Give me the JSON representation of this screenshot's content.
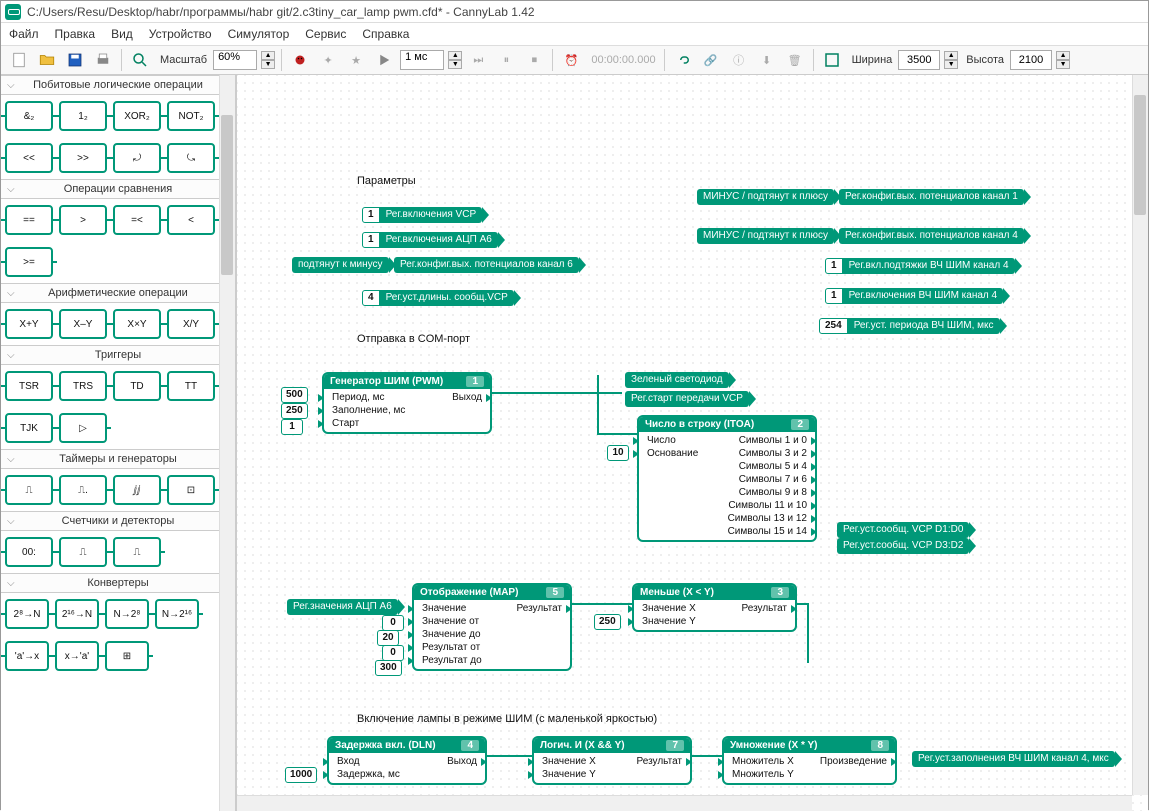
{
  "window": {
    "title": "C:/Users/Resu/Desktop/habr/программы/habr git/2.c3tiny_car_lamp pwm.cfd* - CannyLab 1.42"
  },
  "menu": {
    "file": "Файл",
    "edit": "Правка",
    "view": "Вид",
    "device": "Устройство",
    "simulator": "Симулятор",
    "service": "Сервис",
    "help": "Справка"
  },
  "toolbar": {
    "zoom_label": "Масштаб",
    "zoom_value": "60%",
    "time_step": "1 мс",
    "time_display": "00:00:00.000",
    "width_label": "Ширина",
    "width_value": "3500",
    "height_label": "Высота",
    "height_value": "2100"
  },
  "categories": {
    "bitwise": {
      "title": "Побитовые логические операции",
      "row1": [
        "&₂",
        "1₂",
        "XOR₂",
        "NOT₂"
      ],
      "row2": [
        "<<",
        ">>",
        "⤾",
        "⤿"
      ]
    },
    "compare": {
      "title": "Операции сравнения",
      "row1": [
        "==",
        ">",
        "=<",
        "<"
      ],
      "row2": [
        ">="
      ]
    },
    "arith": {
      "title": "Арифметические операции",
      "row1": [
        "X+Y",
        "X–Y",
        "X×Y",
        "X/Y"
      ]
    },
    "trig": {
      "title": "Триггеры",
      "row1": [
        "TSR",
        "TRS",
        "TD",
        "TT"
      ],
      "row2": [
        "TJK",
        "▷"
      ]
    },
    "timers": {
      "title": "Таймеры и генераторы",
      "row1": [
        "⎍",
        "⎍.",
        "ⅉⅉ",
        "⊡"
      ]
    },
    "counters": {
      "title": "Счетчики и детекторы",
      "row1": [
        "00:",
        "⎍",
        "⎍"
      ]
    },
    "conv": {
      "title": "Конвертеры",
      "row1": [
        "2⁸→N",
        "2¹⁶→N",
        "N→2⁸",
        "N→2¹⁶"
      ],
      "row2": [
        "'a'→x",
        "x→'a'",
        "⊞"
      ]
    }
  },
  "canvas": {
    "labels": {
      "params": "Параметры",
      "com": "Отправка в COM-порт",
      "lamp": "Включение лампы в режиме ШИМ (с маленькой яркостью)"
    },
    "top_left": [
      {
        "num": "1",
        "txt": "Рег.включения VCP"
      },
      {
        "num": "1",
        "txt": "Рег.включения АЦП А6"
      },
      {
        "numtxt": "подтянут к минусу",
        "txt": "Рег.конфиг.вых. потенциалов канал 6"
      },
      {
        "num": "4",
        "txt": "Рег.уст.длины. сообщ.VCP"
      }
    ],
    "top_right": [
      {
        "left": "МИНУС / подтянут к плюсу",
        "right": "Рег.конфиг.вых. потенциалов канал 1"
      },
      {
        "left": "МИНУС / подтянут к плюсу",
        "right": "Рег.конфиг.вых. потенциалов канал 4"
      },
      {
        "num": "1",
        "right": "Рег.вкл.подтяжки ВЧ ШИМ канал 4"
      },
      {
        "num": "1",
        "right": "Рег.включения ВЧ ШИМ канал 4"
      },
      {
        "num": "254",
        "right": "Рег.уст. периода ВЧ ШИМ, мкс"
      }
    ],
    "green_led": "Зеленый светодиод",
    "vcp_start": "Рег.старт передачи VCP",
    "vcp_msg1": "Рег.уст.сообщ. VCP D1:D0",
    "vcp_msg2": "Рег.уст.сообщ. VCP D3:D2",
    "adc_reg": "Рег.значения АЦП А6",
    "pwm_fill": "Рег.уст.заполнения ВЧ ШИМ канал 4, мкс",
    "pwm": {
      "title": "Генератор ШИМ (PWM)",
      "num": "1",
      "in": [
        "Период, мс",
        "Заполнение, мс",
        "Старт"
      ],
      "out": "Выход",
      "vals": [
        "500",
        "250",
        "1"
      ]
    },
    "itoa": {
      "title": "Число в строку (ITOA)",
      "num": "2",
      "in": [
        "Число",
        "Основание"
      ],
      "out": [
        "Символы 1 и 0",
        "Символы 3 и 2",
        "Символы 5 и 4",
        "Символы 7 и 6",
        "Символы 9 и 8",
        "Символы 11 и 10",
        "Символы 13 и 12",
        "Символы 15 и 14"
      ],
      "base": "10"
    },
    "map": {
      "title": "Отображение (MAP)",
      "num": "5",
      "in": [
        "Значение",
        "Значение от",
        "Значение до",
        "Результат от",
        "Результат до"
      ],
      "out": "Результат",
      "vals": [
        "",
        "0",
        "20",
        "0",
        "300"
      ]
    },
    "less": {
      "title": "Меньше (X < Y)",
      "num": "3",
      "in": [
        "Значение X",
        "Значение Y"
      ],
      "out": "Результат",
      "y": "250"
    },
    "dln": {
      "title": "Задержка вкл. (DLN)",
      "num": "4",
      "in": [
        "Вход",
        "Задержка, мс"
      ],
      "out": "Выход",
      "delay": "1000"
    },
    "and": {
      "title": "Логич. И (X && Y)",
      "num": "7",
      "in": [
        "Значение X",
        "Значение Y"
      ],
      "out": "Результат"
    },
    "mul": {
      "title": "Умножение (X * Y)",
      "num": "8",
      "in": [
        "Множитель X",
        "Множитель Y"
      ],
      "out": "Произведение"
    }
  }
}
